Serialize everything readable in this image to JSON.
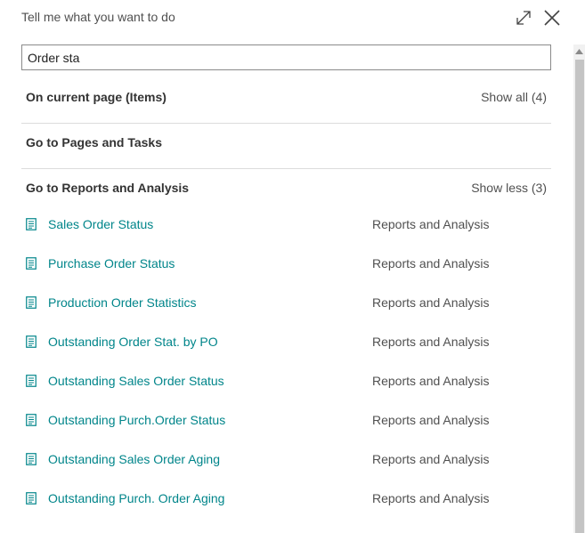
{
  "header": {
    "title": "Tell me what you want to do"
  },
  "search": {
    "value": "Order sta"
  },
  "sections": {
    "current_page": {
      "title": "On current page (Items)",
      "link": "Show all (4)"
    },
    "pages_tasks": {
      "title": "Go to Pages and Tasks"
    },
    "reports": {
      "title": "Go to Reports and Analysis",
      "link": "Show less (3)"
    }
  },
  "results": [
    {
      "name": "Sales Order Status",
      "category": "Reports and Analysis",
      "icon": "report-icon"
    },
    {
      "name": "Purchase Order Status",
      "category": "Reports and Analysis",
      "icon": "report-icon"
    },
    {
      "name": "Production Order Statistics",
      "category": "Reports and Analysis",
      "icon": "report-icon"
    },
    {
      "name": "Outstanding Order Stat. by PO",
      "category": "Reports and Analysis",
      "icon": "report-icon"
    },
    {
      "name": "Outstanding Sales Order Status",
      "category": "Reports and Analysis",
      "icon": "report-icon"
    },
    {
      "name": "Outstanding Purch.Order Status",
      "category": "Reports and Analysis",
      "icon": "report-icon"
    },
    {
      "name": "Outstanding Sales Order Aging",
      "category": "Reports and Analysis",
      "icon": "report-icon"
    },
    {
      "name": "Outstanding Purch. Order Aging",
      "category": "Reports and Analysis",
      "icon": "report-icon"
    }
  ],
  "colors": {
    "link": "#00858a",
    "text": "#212121",
    "muted": "#505050",
    "divider": "#dcdcdc"
  }
}
